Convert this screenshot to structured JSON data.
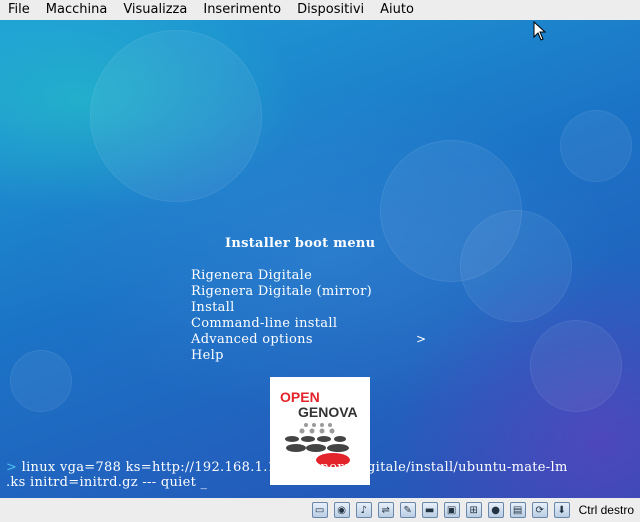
{
  "menubar": {
    "items": [
      "File",
      "Macchina",
      "Visualizza",
      "Inserimento",
      "Dispositivi",
      "Aiuto"
    ]
  },
  "boot_menu": {
    "title": "Installer boot menu",
    "items": [
      "Rigenera Digitale",
      "Rigenera Digitale (mirror)",
      "Install",
      "Command-line install",
      "Advanced options",
      "Help"
    ],
    "submenu_arrow": ">"
  },
  "logo": {
    "line1": "OPEN",
    "line2": "GENOVA"
  },
  "command": {
    "prompt": ">",
    "line1": " linux vga=788 ks=http://192.168.1.10/RigeneraDigitale/install/ubuntu-mate-lm",
    "line2": ".ks initrd=initrd.gz --- quiet _"
  },
  "statusbar": {
    "icons": [
      "hard-disk-icon",
      "optical-drive-icon",
      "audio-icon",
      "usb-icon",
      "pen-icon",
      "folder-icon",
      "display-icon",
      "network-icon",
      "record-icon",
      "capture-icon",
      "shared-clipboard-icon",
      "arrow-down-icon"
    ],
    "host_key": "Ctrl destro"
  },
  "colors": {
    "accent": "#4cc3f0",
    "logo_red": "#e3242b"
  }
}
